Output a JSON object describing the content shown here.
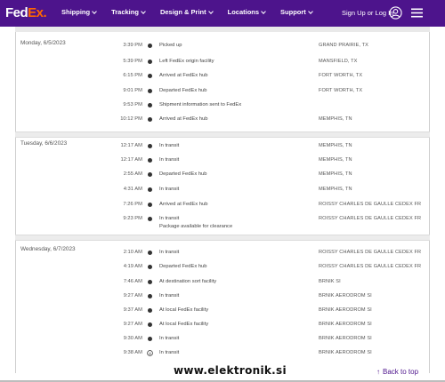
{
  "header": {
    "logo_fed": "Fed",
    "logo_ex": "Ex.",
    "nav": [
      "Shipping",
      "Tracking",
      "Design & Print",
      "Locations",
      "Support"
    ],
    "signin": "Sign Up or Log In"
  },
  "days": [
    {
      "date": "Monday, 6/5/2023",
      "events": [
        {
          "time": "3:39 PM",
          "status": "Picked up",
          "location": "GRAND PRAIRIE, TX"
        },
        {
          "time": "5:39 PM",
          "status": "Left FedEx origin facility",
          "location": "MANSFIELD, TX"
        },
        {
          "time": "6:15 PM",
          "status": "Arrived at FedEx hub",
          "location": "FORT WORTH, TX"
        },
        {
          "time": "9:01 PM",
          "status": "Departed FedEx hub",
          "location": "FORT WORTH, TX"
        },
        {
          "time": "9:53 PM",
          "status": "Shipment information sent to FedEx",
          "location": ""
        },
        {
          "time": "10:12 PM",
          "status": "Arrived at FedEx hub",
          "location": "MEMPHIS, TN"
        }
      ]
    },
    {
      "date": "Tuesday, 6/6/2023",
      "events": [
        {
          "time": "12:17 AM",
          "status": "In transit",
          "location": "MEMPHIS, TN"
        },
        {
          "time": "12:17 AM",
          "status": "In transit",
          "location": "MEMPHIS, TN"
        },
        {
          "time": "2:55 AM",
          "status": "Departed FedEx hub",
          "location": "MEMPHIS, TN"
        },
        {
          "time": "4:31 AM",
          "status": "In transit",
          "location": "MEMPHIS, TN"
        },
        {
          "time": "7:26 PM",
          "status": "Arrived at FedEx hub",
          "location": "ROISSY CHARLES DE GAULLE CEDEX FR"
        },
        {
          "time": "9:23 PM",
          "status": "In transit",
          "sub": "Package available for clearance",
          "location": "ROISSY CHARLES DE GAULLE CEDEX FR"
        }
      ]
    },
    {
      "date": "Wednesday, 6/7/2023",
      "events": [
        {
          "time": "2:10 AM",
          "status": "In transit",
          "location": "ROISSY CHARLES DE GAULLE CEDEX FR"
        },
        {
          "time": "4:19 AM",
          "status": "Departed FedEx hub",
          "location": "ROISSY CHARLES DE GAULLE CEDEX FR"
        },
        {
          "time": "7:46 AM",
          "status": "At destination sort facility",
          "location": "BRNIK SI"
        },
        {
          "time": "9:27 AM",
          "status": "In transit",
          "location": "BRNIK AERODROM SI"
        },
        {
          "time": "9:37 AM",
          "status": "At local FedEx facility",
          "location": "BRNIK AERODROM SI"
        },
        {
          "time": "9:27 AM",
          "status": "At local FedEx facility",
          "location": "BRNIK AERODROM SI"
        },
        {
          "time": "9:30 AM",
          "status": "In transit",
          "location": "BRNIK AERODROM SI"
        },
        {
          "time": "9:38 AM",
          "status": "In transit",
          "location": "BRNIK AERODROM SI"
        }
      ]
    }
  ],
  "back_to_top": "Back to top",
  "watermark": "www.elektronik.si",
  "colors": {
    "brand_purple": "#4d148c",
    "brand_orange": "#ff6600"
  }
}
